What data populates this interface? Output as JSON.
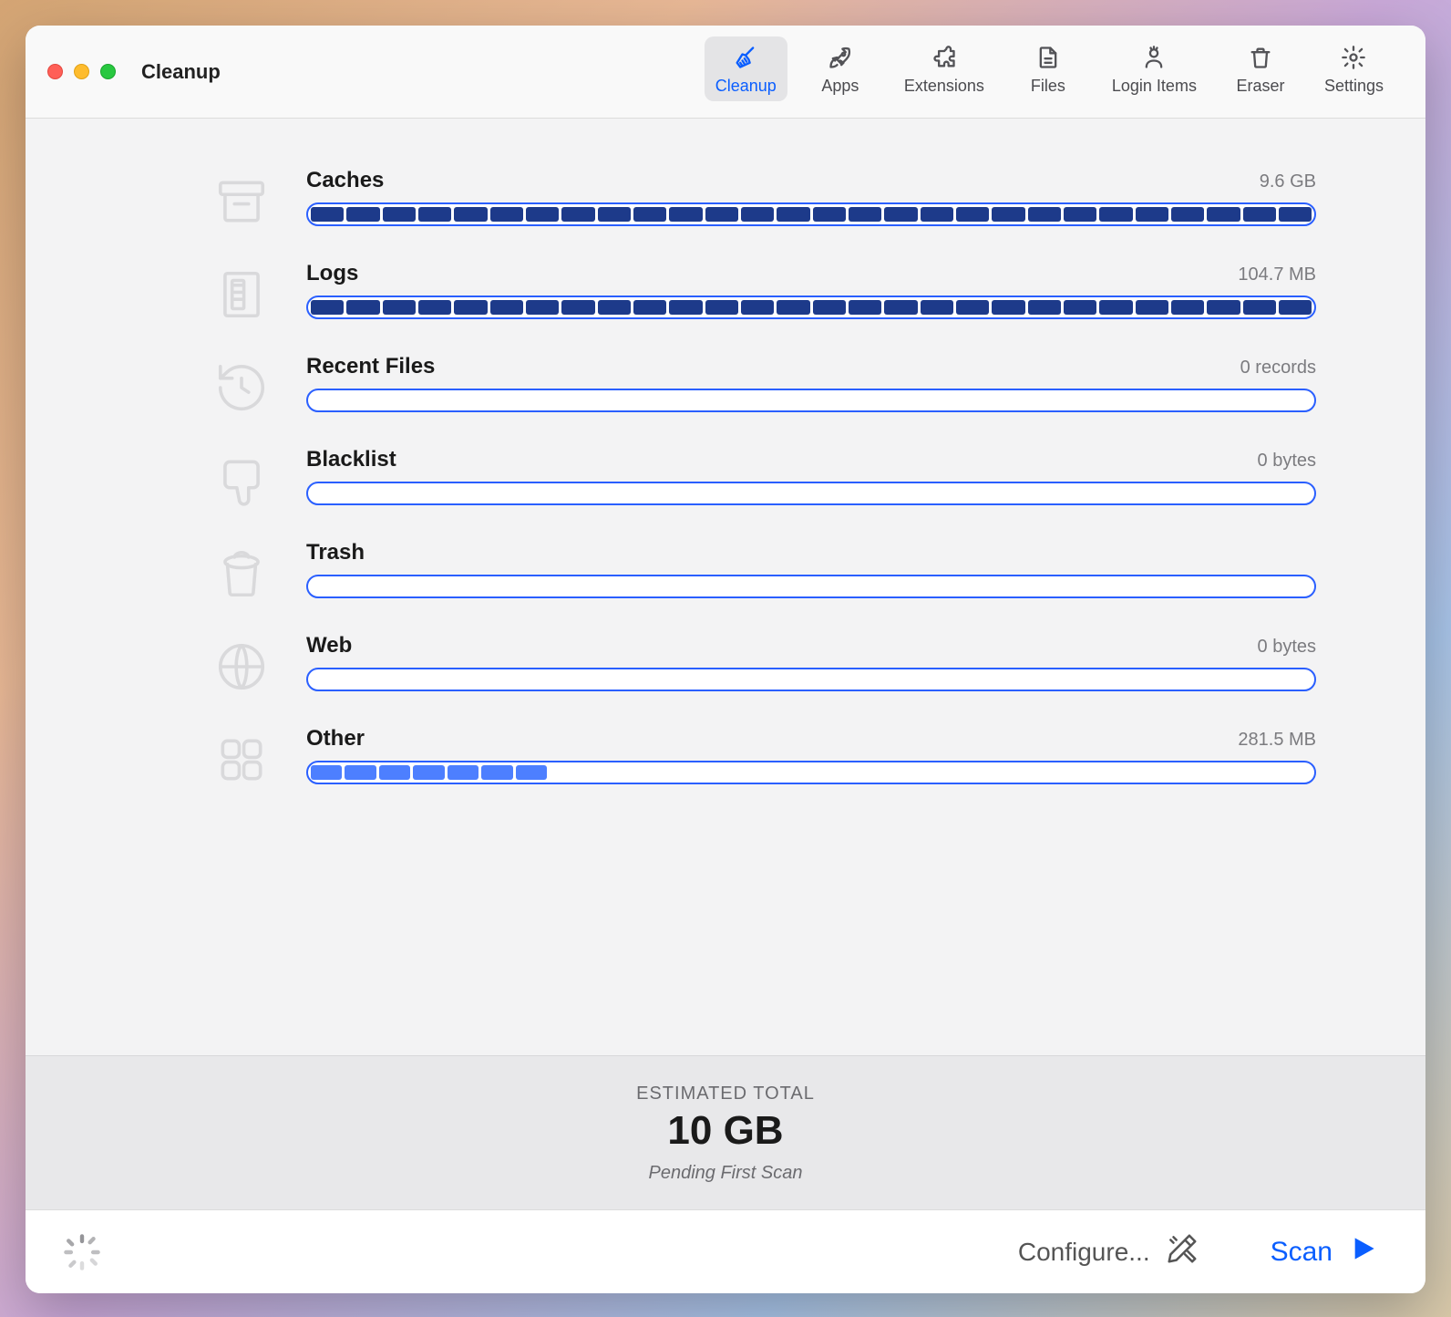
{
  "window": {
    "title": "Cleanup"
  },
  "tabs": [
    {
      "label": "Cleanup",
      "icon": "broom-icon"
    },
    {
      "label": "Apps",
      "icon": "rocket-icon"
    },
    {
      "label": "Extensions",
      "icon": "puzzle-icon"
    },
    {
      "label": "Files",
      "icon": "file-icon"
    },
    {
      "label": "Login Items",
      "icon": "person-icon"
    },
    {
      "label": "Eraser",
      "icon": "trash-icon"
    },
    {
      "label": "Settings",
      "icon": "gear-icon"
    }
  ],
  "categories": [
    {
      "name": "Caches",
      "size": "9.6 GB",
      "fill_pct": 100,
      "segments": 28,
      "style": "dark",
      "icon": "archive-box-icon"
    },
    {
      "name": "Logs",
      "size": "104.7 MB",
      "fill_pct": 100,
      "segments": 28,
      "style": "dark",
      "icon": "log-icon"
    },
    {
      "name": "Recent Files",
      "size": "0 records",
      "fill_pct": 0,
      "segments": 0,
      "style": "light",
      "icon": "clock-back-icon"
    },
    {
      "name": "Blacklist",
      "size": "0 bytes",
      "fill_pct": 0,
      "segments": 0,
      "style": "light",
      "icon": "thumbs-down-icon"
    },
    {
      "name": "Trash",
      "size": "",
      "fill_pct": 0,
      "segments": 0,
      "style": "light",
      "icon": "bin-icon"
    },
    {
      "name": "Web",
      "size": "0 bytes",
      "fill_pct": 0,
      "segments": 0,
      "style": "light",
      "icon": "globe-icon"
    },
    {
      "name": "Other",
      "size": "281.5 MB",
      "fill_pct": 24,
      "segments": 7,
      "style": "light",
      "icon": "grid-icon"
    }
  ],
  "summary": {
    "label": "ESTIMATED TOTAL",
    "total": "10 GB",
    "status": "Pending First Scan"
  },
  "footer": {
    "configure_label": "Configure...",
    "scan_label": "Scan"
  }
}
